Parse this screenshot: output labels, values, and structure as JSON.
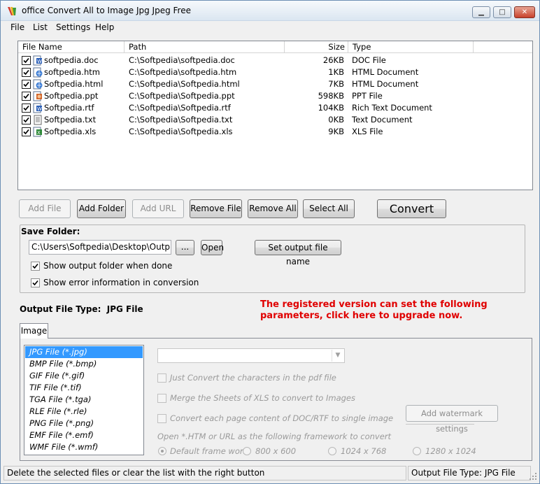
{
  "window": {
    "title": "office Convert All to Image Jpg Jpeg Free",
    "minimize_glyph": "▁",
    "maximize_glyph": "□",
    "close_glyph": "✕"
  },
  "menu": [
    "File",
    "List",
    "Settings",
    "Help"
  ],
  "file_list": {
    "columns": [
      "File Name",
      "Path",
      "Size",
      "Type"
    ],
    "rows": [
      {
        "name": "softpedia.doc",
        "path": "C:\\Softpedia\\softpedia.doc",
        "size": "26KB",
        "type": "DOC File",
        "checked": true,
        "icon": "word-doc-icon"
      },
      {
        "name": "softpedia.htm",
        "path": "C:\\Softpedia\\softpedia.htm",
        "size": "1KB",
        "type": "HTML Document",
        "checked": true,
        "icon": "html-doc-icon"
      },
      {
        "name": "Softpedia.html",
        "path": "C:\\Softpedia\\Softpedia.html",
        "size": "7KB",
        "type": "HTML Document",
        "checked": true,
        "icon": "html-doc-icon"
      },
      {
        "name": "Softpedia.ppt",
        "path": "C:\\Softpedia\\Softpedia.ppt",
        "size": "598KB",
        "type": "PPT File",
        "checked": true,
        "icon": "powerpoint-doc-icon"
      },
      {
        "name": "Softpedia.rtf",
        "path": "C:\\Softpedia\\Softpedia.rtf",
        "size": "104KB",
        "type": "Rich Text Document",
        "checked": true,
        "icon": "word-doc-icon"
      },
      {
        "name": "Softpedia.txt",
        "path": "C:\\Softpedia\\Softpedia.txt",
        "size": "0KB",
        "type": "Text Document",
        "checked": true,
        "icon": "text-doc-icon"
      },
      {
        "name": "Softpedia.xls",
        "path": "C:\\Softpedia\\Softpedia.xls",
        "size": "9KB",
        "type": "XLS File",
        "checked": true,
        "icon": "excel-doc-icon"
      }
    ]
  },
  "toolbar": {
    "add_file": "Add File",
    "add_folder": "Add Folder",
    "add_url": "Add URL",
    "remove_file": "Remove File",
    "remove_all": "Remove All",
    "select_all": "Select All",
    "convert": "Convert"
  },
  "save_folder": {
    "label": "Save Folder:",
    "path": "C:\\Users\\Softpedia\\Desktop\\Output Files",
    "browse": "...",
    "open": "Open",
    "set_name": "Set output file name",
    "show_output_when_done": {
      "label": "Show output folder when done",
      "checked": true
    },
    "show_errors": {
      "label": "Show error information in conversion",
      "checked": true
    }
  },
  "output_type": {
    "label": "Output File Type:",
    "value": "JPG File"
  },
  "upgrade_notice": {
    "line1": "The registered version can set the following",
    "line2": "parameters, click here to upgrade now."
  },
  "tabs": {
    "image": "Image"
  },
  "formats": [
    "JPG File  (*.jpg)",
    "BMP File  (*.bmp)",
    "GIF File  (*.gif)",
    "TIF File  (*.tif)",
    "TGA File  (*.tga)",
    "RLE File  (*.rle)",
    "PNG File  (*.png)",
    "EMF File  (*.emf)",
    "WMF File  (*.wmf)"
  ],
  "selected_format_index": 0,
  "options": {
    "just_convert_chars": "Just Convert the characters in the pdf file",
    "merge_sheets": "Merge the Sheets of XLS to convert to Images",
    "each_page_single": "Convert each page content of DOC/RTF to single image",
    "watermark_button": "Add watermark settings",
    "framework_label": "Open *.HTM or URL as the following framework to convert",
    "framework_options": [
      "Default frame work",
      "800 x 600",
      "1024 x 768",
      "1280 x 1024"
    ],
    "framework_selected": 0
  },
  "status": {
    "left": "Delete the selected files or clear the list with the right button",
    "right": "Output File Type:  JPG File"
  }
}
